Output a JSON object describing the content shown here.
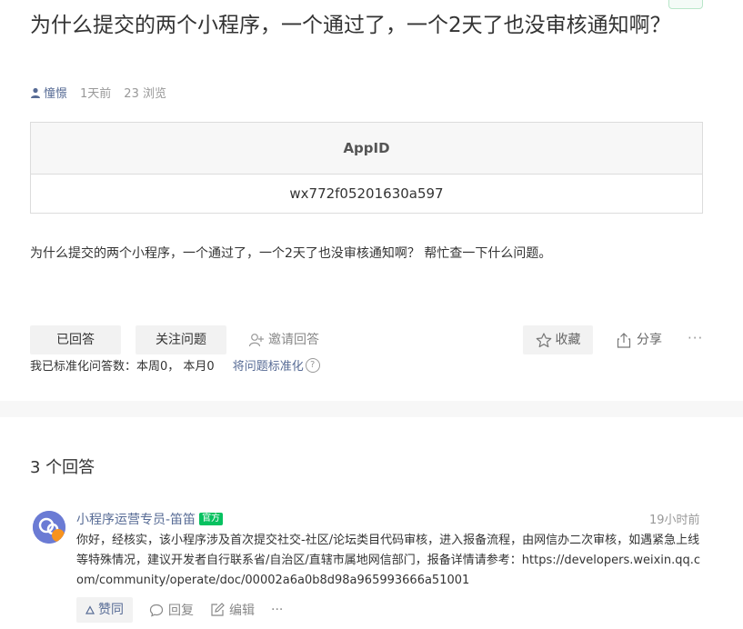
{
  "corner_badge": "",
  "question": {
    "title": "为什么提交的两个小程序，一个通过了，一个2天了也没审核通知啊？",
    "author": "憧憬",
    "time": "1天前",
    "views": "23 浏览",
    "table": {
      "header": "AppID",
      "value": "wx772f05201630a597"
    },
    "body": "为什么提交的两个小程序，一个通过了，一个2天了也没审核通知啊？ 帮忙查一下什么问题。"
  },
  "actions": {
    "answered": "已回答",
    "follow": "关注问题",
    "invite": "邀请回答",
    "collect": "收藏",
    "share": "分享",
    "more": "···"
  },
  "stats": {
    "text": "我已标准化问答数：本周0，  本月0",
    "link": "将问题标准化",
    "help": "?"
  },
  "answers_header": "3 个回答",
  "answer": {
    "author": "小程序运营专员-笛笛",
    "badge": "官方",
    "time": "19小时前",
    "text": "你好，经核实，该小程序涉及首次提交社交-社区/论坛类目代码审核，进入报备流程，由网信办二次审核，如遇紧急上线等特殊情况，建议开发者自行联系省/自治区/直辖市属地网信部门，报备详情请参考：https://developers.weixin.qq.com/community/operate/doc/00002a6a0b8d98a965993666a51001",
    "like": "赞同",
    "reply": "回复",
    "edit": "编辑",
    "more": "···"
  },
  "colors": {
    "link": "#576b95",
    "official": "#07c160",
    "muted": "#999999"
  },
  "icons": [
    "user-icon",
    "invite-user-icon",
    "star-icon",
    "share-icon",
    "question-icon",
    "thumb-up-icon",
    "comment-icon",
    "edit-icon"
  ]
}
